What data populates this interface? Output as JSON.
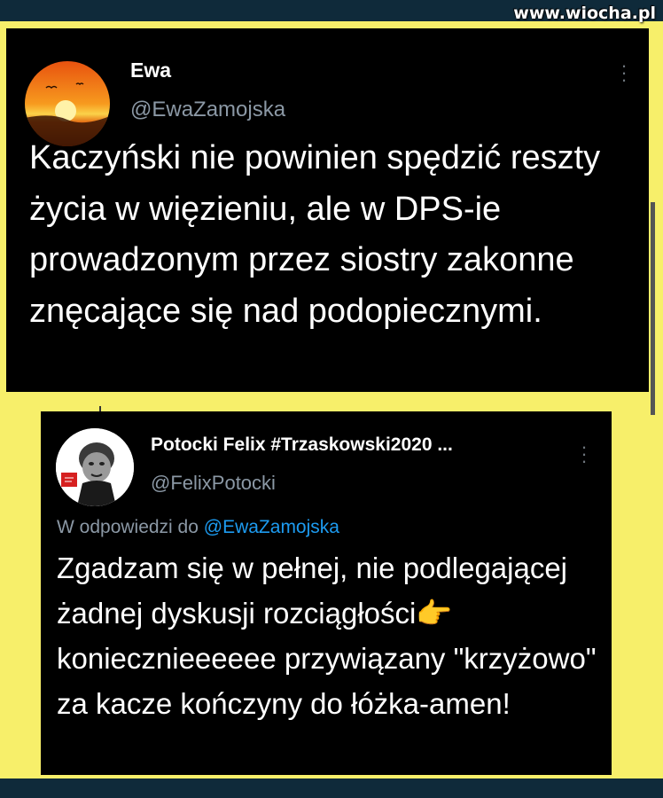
{
  "watermark": "www.wiocha.pl",
  "tweet1": {
    "name": "Ewa",
    "handle": "@EwaZamojska",
    "text": "Kaczyński nie powinien spędzić reszty życia w więzieniu, ale w DPS-ie prowadzonym przez siostry zakonne znęcające się nad podopiecznymi.",
    "avatar_icon": "sunset-avatar",
    "more_icon": "more-vertical-icon"
  },
  "tweet2": {
    "name": "Potocki Felix #Trzaskowski2020 ...",
    "handle": "@FelixPotocki",
    "reply_prefix": "W odpowiedzi do",
    "reply_to": "@EwaZamojska",
    "text": "Zgadzam się w pełnej, nie podlegającej żadnej dyskusji rozciągłości👉 koniecznieeeeee przywiązany \"krzyżowo\" za kacze kończyny do łóżka-amen!",
    "avatar_icon": "caricature-avatar",
    "more_icon": "more-vertical-icon"
  },
  "colors": {
    "background": "#f7ef6a",
    "tweet_bg": "#000000",
    "muted_text": "#8b98a5",
    "mention": "#1d9bf0",
    "frame": "#0f2a3a"
  }
}
